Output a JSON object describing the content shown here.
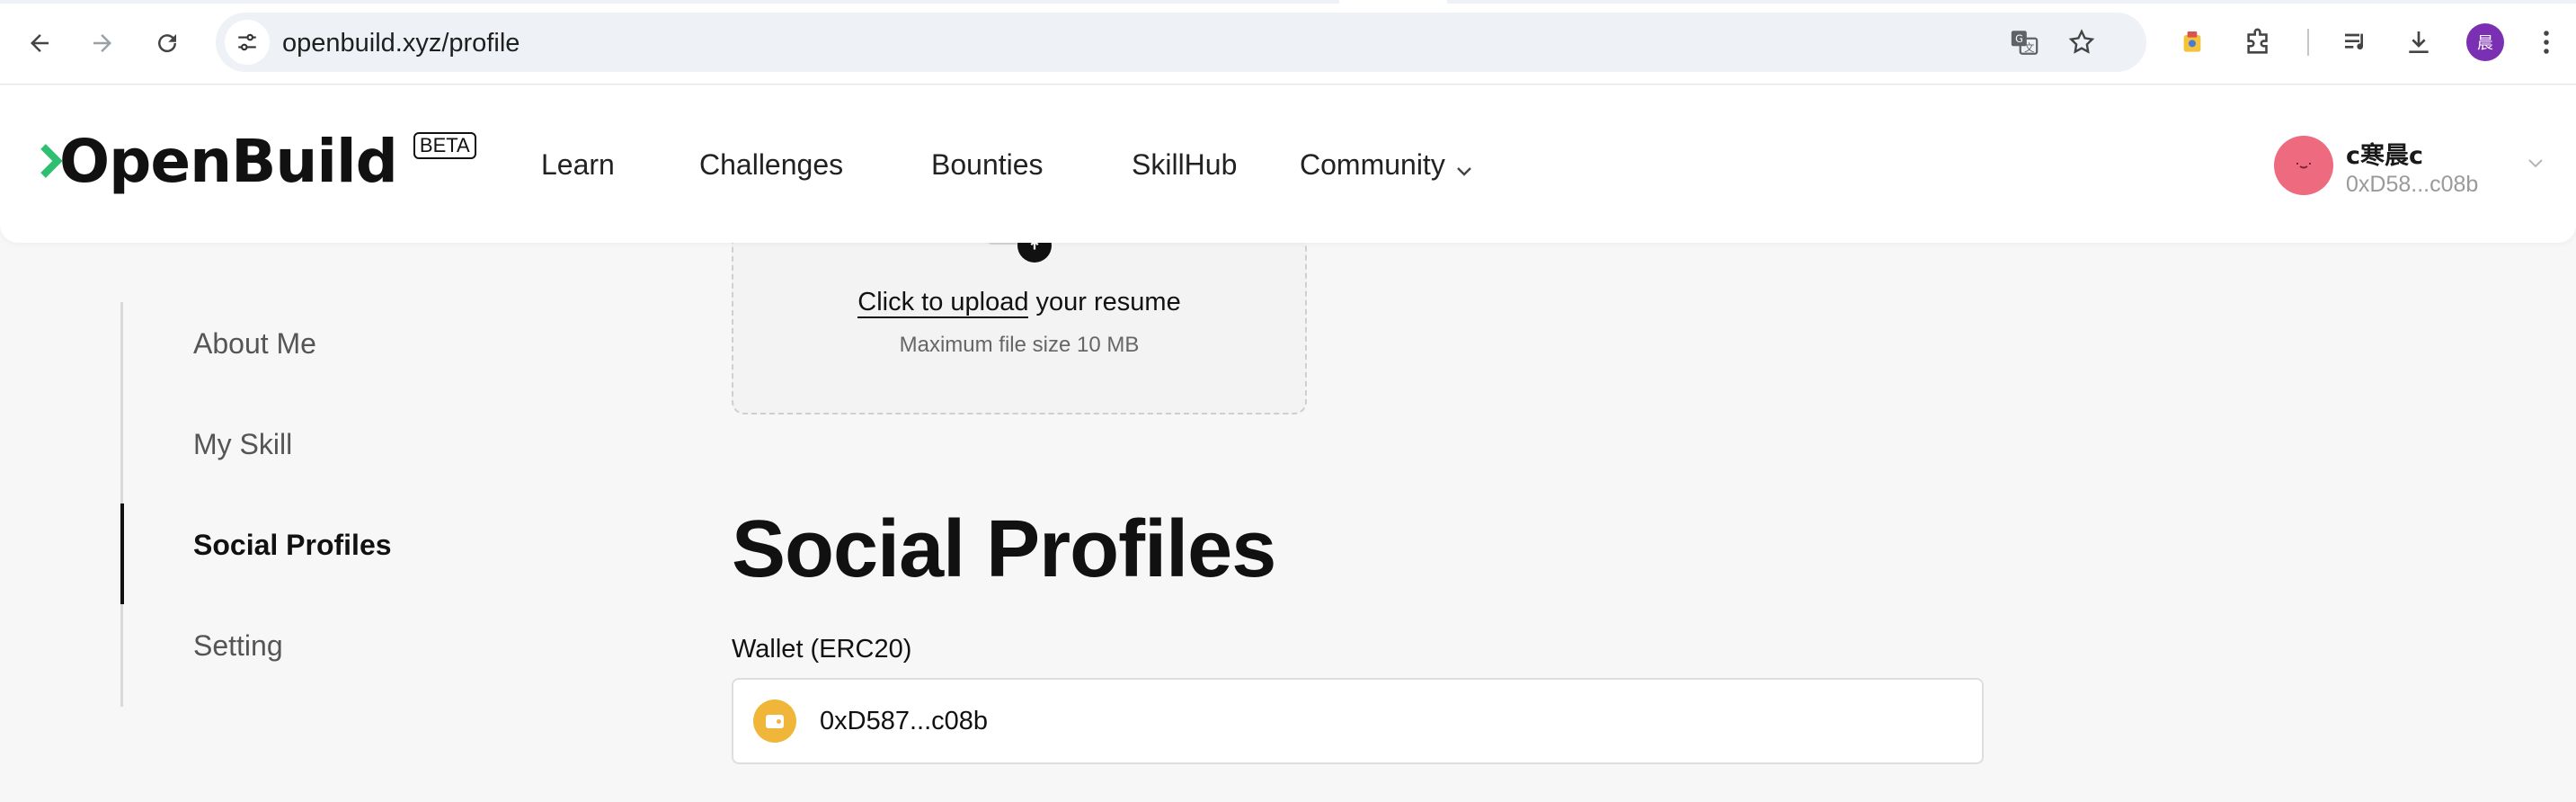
{
  "browser": {
    "url": "openbuild.xyz/profile",
    "profile_initial": "晨"
  },
  "site": {
    "logo_text": "OpenBuild",
    "beta_label": "BETA",
    "nav": {
      "learn": "Learn",
      "challenges": "Challenges",
      "bounties": "Bounties",
      "skillhub": "SkillHub",
      "community": "Community"
    },
    "user": {
      "name": "c寒晨c",
      "address": "0xD58...c08b"
    }
  },
  "sidebar": {
    "items": [
      {
        "label": "About Me"
      },
      {
        "label": "My Skill"
      },
      {
        "label": "Social Profiles",
        "active": true
      },
      {
        "label": "Setting"
      }
    ]
  },
  "upload": {
    "link_text": "Click to upload",
    "rest_text": " your resume",
    "hint": "Maximum file size 10 MB"
  },
  "social": {
    "title": "Social Profiles",
    "wallet_label": "Wallet (ERC20)",
    "wallet_value": "0xD587...c08b"
  },
  "colors": {
    "accent_green": "#2fbf71",
    "avatar_pink": "#ee6a7f",
    "wallet_gold": "#f0b63a",
    "profile_purple": "#7b2fb3"
  }
}
